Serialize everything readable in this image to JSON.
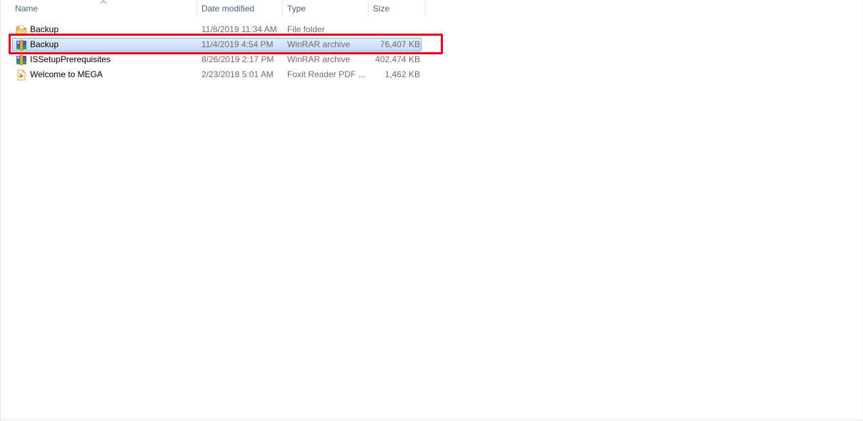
{
  "columns": {
    "name": "Name",
    "date_modified": "Date modified",
    "type": "Type",
    "size": "Size",
    "sort_icon": "sort-ascending-icon"
  },
  "files": [
    {
      "name": "Backup",
      "date": "11/8/2019 11:34 AM",
      "type": "File folder",
      "size": "",
      "icon": "folder-icon",
      "selected": false
    },
    {
      "name": "Backup",
      "date": "11/4/2019 4:54 PM",
      "type": "WinRAR archive",
      "size": "76,407 KB",
      "icon": "winrar-archive-icon",
      "selected": true
    },
    {
      "name": "ISSetupPrerequisites",
      "date": "8/26/2019 2:17 PM",
      "type": "WinRAR archive",
      "size": "402,474 KB",
      "icon": "winrar-archive-icon",
      "selected": false
    },
    {
      "name": "Welcome to MEGA",
      "date": "2/23/2018 5:01 AM",
      "type": "Foxit Reader PDF ...",
      "size": "1,462 KB",
      "icon": "pdf-document-icon",
      "selected": false
    }
  ],
  "colors": {
    "highlight_box": "#e3001b",
    "selection": "#c5daf6",
    "header_text": "#4c607a"
  }
}
